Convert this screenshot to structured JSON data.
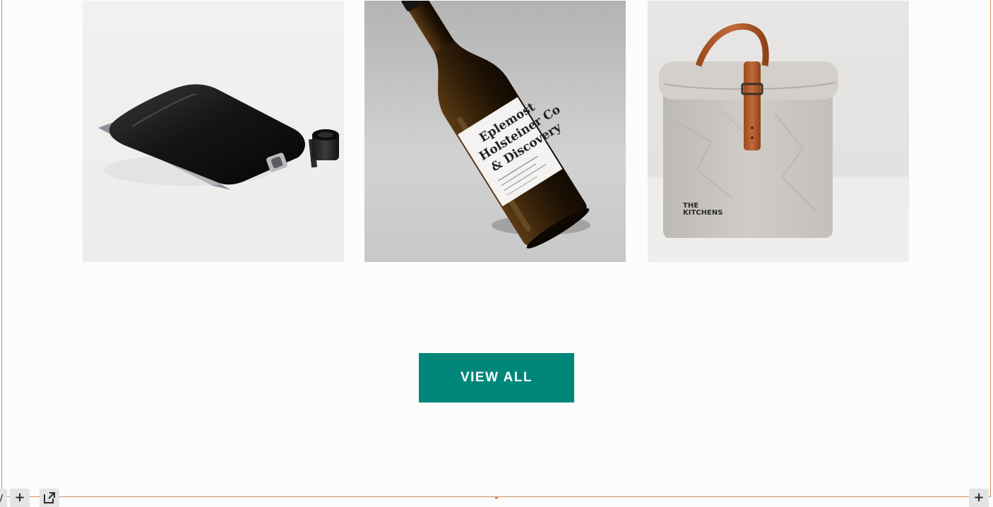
{
  "products": [
    {
      "name": "black flask pouch",
      "image_icon": "flask-pouch-image"
    },
    {
      "name": "wine bottle",
      "image_icon": "wine-bottle-image",
      "label_lines": [
        "Eplemost",
        "Holsteiner Co",
        "& Discovery"
      ]
    },
    {
      "name": "paper lunch bag",
      "image_icon": "lunch-bag-image",
      "label_lines": [
        "THE",
        "KITCHENS"
      ]
    }
  ],
  "actions": {
    "view_all_label": "VIEW ALL"
  },
  "toolbar": {
    "left_slash_glyph": "/",
    "plus_glyph": "+",
    "popout_icon": "popout-icon",
    "right_plus_glyph": "+"
  },
  "colors": {
    "accent": "#00877a",
    "frame": "#d08b5f",
    "background": "#fdfcfc"
  }
}
